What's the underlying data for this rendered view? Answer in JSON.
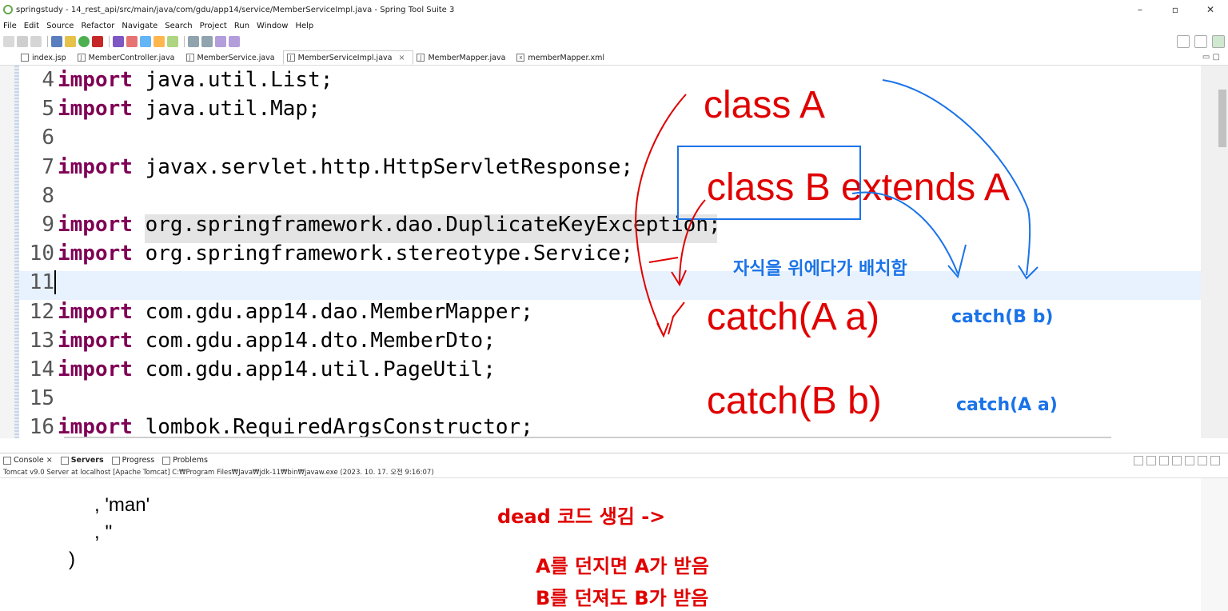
{
  "window": {
    "title": "springstudy - 14_rest_api/src/main/java/com/gdu/app14/service/MemberServiceImpl.java - Spring Tool Suite 3",
    "minimize": "–",
    "maximize": "▫",
    "close": "✕"
  },
  "menu": [
    "File",
    "Edit",
    "Source",
    "Refactor",
    "Navigate",
    "Search",
    "Project",
    "Run",
    "Window",
    "Help"
  ],
  "editor_tabs": [
    {
      "icon": "jsp",
      "label": "index.jsp"
    },
    {
      "icon": "J",
      "label": "MemberController.java"
    },
    {
      "icon": "J",
      "label": "MemberService.java"
    },
    {
      "icon": "J",
      "label": "MemberServiceImpl.java",
      "active": true
    },
    {
      "icon": "J",
      "label": "MemberMapper.java"
    },
    {
      "icon": "x",
      "label": "memberMapper.xml"
    }
  ],
  "code_lines": [
    {
      "n": "4",
      "kw": "import",
      "rest": " java.util.List;"
    },
    {
      "n": "5",
      "kw": "import",
      "rest": " java.util.Map;"
    },
    {
      "n": "6",
      "kw": "",
      "rest": ""
    },
    {
      "n": "7",
      "kw": "import",
      "rest": " javax.servlet.http.HttpServletResponse;"
    },
    {
      "n": "8",
      "kw": "",
      "rest": ""
    },
    {
      "n": "9",
      "kw": "import",
      "rest": " org.springframework.dao.DuplicateKeyException;"
    },
    {
      "n": "10",
      "kw": "import",
      "rest": " org.springframework.stereotype.Service;"
    },
    {
      "n": "11",
      "kw": "",
      "rest": ""
    },
    {
      "n": "12",
      "kw": "import",
      "rest": " com.gdu.app14.dao.MemberMapper;"
    },
    {
      "n": "13",
      "kw": "import",
      "rest": " com.gdu.app14.dto.MemberDto;"
    },
    {
      "n": "14",
      "kw": "import",
      "rest": " com.gdu.app14.util.PageUtil;"
    },
    {
      "n": "15",
      "kw": "",
      "rest": ""
    },
    {
      "n": "16",
      "kw": "import",
      "rest": " lombok.RequiredArgsConstructor;"
    }
  ],
  "annotations": {
    "class_a": "class A",
    "class_b": "class B extends A",
    "catch_a_red": "catch(A a)",
    "catch_b_red": "catch(B b)",
    "child_on_top": "자식을 위에다가 배치함",
    "catch_b_blue": "catch(B b)",
    "catch_a_blue": "catch(A a)",
    "dead_code": "dead 코드 생김 ->",
    "throw_a": "A를 던지면 A가 받음",
    "throw_b": "B를 던져도 B가 받음"
  },
  "console_tabs": [
    {
      "label": "Console",
      "closable": true
    },
    {
      "label": "Servers",
      "bold": true
    },
    {
      "label": "Progress"
    },
    {
      "label": "Problems"
    }
  ],
  "console_status": "Tomcat v9.0 Server at localhost [Apache Tomcat] C:₩Program Files₩Java₩jdk-11₩bin₩javaw.exe  (2023. 10. 17. 오전 9:16:07)",
  "console_lines": [
    ", 'man'",
    ", ''",
    ")"
  ]
}
